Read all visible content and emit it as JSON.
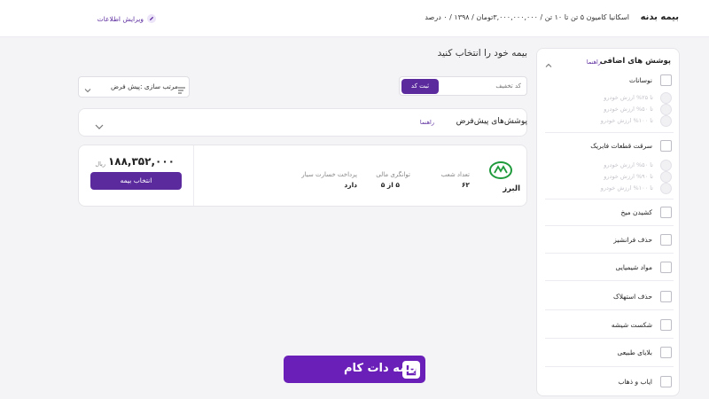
{
  "header": {
    "title": "بیمه بدنه",
    "summary": "اسکانیا کامیون ۵ تن تا ۱۰ تن / ۳,۰۰۰,۰۰۰,۰۰۰تومان / ۱۳۹۸ / ۰ درصد",
    "edit_label": "ویرایش اطلاعات"
  },
  "main": {
    "heading": "بیمه خود را انتخاب کنید",
    "discount": {
      "placeholder": "کد تخفیف",
      "submit_label": "ثبت کد"
    },
    "sort": {
      "label": "مرتب سازی :پیش فرض"
    },
    "default_coverages": {
      "title": "پوشش‌های پیش‌فرض",
      "guide": "راهنما"
    }
  },
  "result": {
    "company": "البرز",
    "stats": [
      {
        "label": "تعداد شعب",
        "value": "۶۲"
      },
      {
        "label": "توانگری مالی",
        "value": "۵ از ۵"
      },
      {
        "label": "پرداخت خسارت سیار",
        "value": "دارد"
      }
    ],
    "price": "۱۸۸,۳۵۲,۰۰۰",
    "currency": "ریال",
    "select_label": "انتخاب بیمه"
  },
  "sidebar": {
    "title": "پوشش های اضافی",
    "guide": "راهنما",
    "items": [
      {
        "label": "نوسانات",
        "options": [
          "تا ۲۵% ارزش خودرو",
          "تا ۵۰% ارزش خودرو",
          "تا ۱۰۰% ارزش خودرو"
        ]
      },
      {
        "label": "سرقت قطعات فابریک",
        "options": [
          "تا ۵۰% ارزش خودرو",
          "تا ۹۰% ارزش خودرو",
          "تا ۱۰۰% ارزش خودرو"
        ]
      },
      {
        "label": "کشیدن میخ"
      },
      {
        "label": "حذف فرانشیز"
      },
      {
        "label": "مواد شیمیایی"
      },
      {
        "label": "حذف استهلاک"
      },
      {
        "label": "شکست شیشه"
      },
      {
        "label": "بلایای طبیعی"
      },
      {
        "label": "ایاب و ذهاب"
      }
    ]
  },
  "brand": {
    "logo_text": "بیمه دات کام"
  },
  "colors": {
    "accent": "#5b2b9e",
    "logo_bg": "#6a1fb8",
    "insurer_green": "#1f9a3c"
  },
  "icons": {
    "edit": "pencil-icon",
    "sort": "sort-lines-icon",
    "dropdown": "chevron-down-icon",
    "collapse": "chevron-up-icon"
  }
}
